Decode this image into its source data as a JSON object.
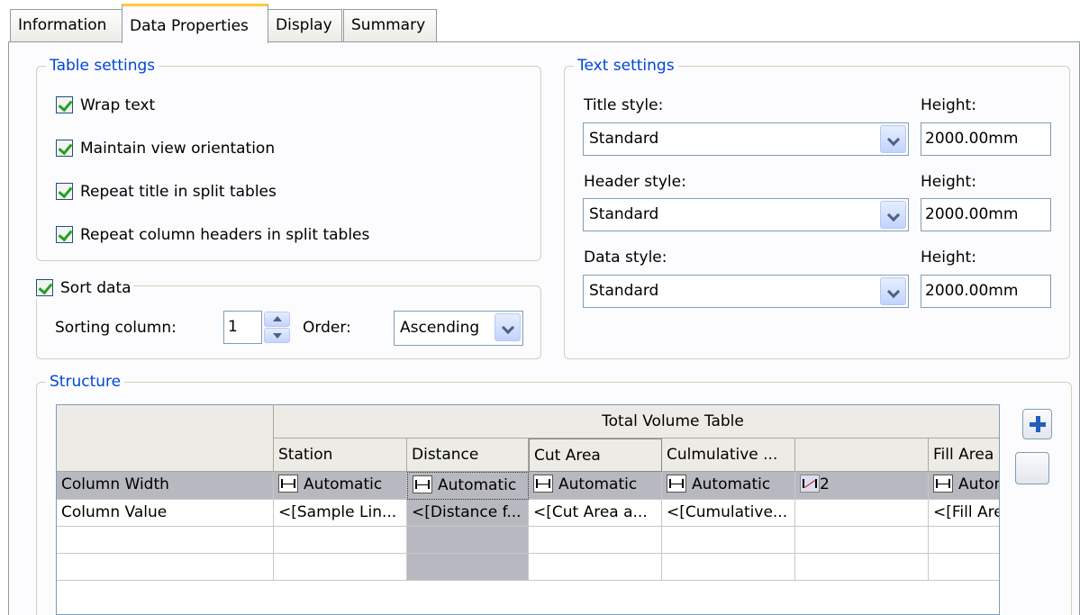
{
  "tabs": [
    "Information",
    "Data Properties",
    "Display",
    "Summary"
  ],
  "table_settings": {
    "title": "Table settings",
    "options": [
      "Wrap text",
      "Maintain view orientation",
      "Repeat title in split tables",
      "Repeat column headers in split tables"
    ]
  },
  "sort": {
    "title": "Sort data",
    "column_label": "Sorting column:",
    "column_value": "1",
    "order_label": "Order:",
    "order_value": "Ascending"
  },
  "text_settings": {
    "title": "Text settings",
    "height_label": "Height:",
    "rows": [
      {
        "label": "Title style:",
        "style": "Standard",
        "height": "2000.00mm"
      },
      {
        "label": "Header style:",
        "style": "Standard",
        "height": "2000.00mm"
      },
      {
        "label": "Data style:",
        "style": "Standard",
        "height": "2000.00mm"
      }
    ]
  },
  "structure": {
    "title": "Structure",
    "group_header": "Total Volume Table",
    "columns": [
      "Station",
      "Distance",
      "Cut Area",
      "Culmulative ...",
      "",
      "Fill Area"
    ],
    "row_labels": [
      "Column Width",
      "Column Value"
    ],
    "widths": [
      "Automatic",
      "Automatic",
      "Automatic",
      "Automatic",
      "2",
      "Automatic"
    ],
    "values": [
      "<[Sample Lin...",
      "<[Distance f...",
      "<[Cut Area a...",
      "<[Cumulative...",
      "",
      "<[Fill Area"
    ]
  },
  "colors": {
    "group_title": "#0046d5",
    "tab_highlight": "#ffc83c",
    "selected_row": "#b8b8c0"
  }
}
